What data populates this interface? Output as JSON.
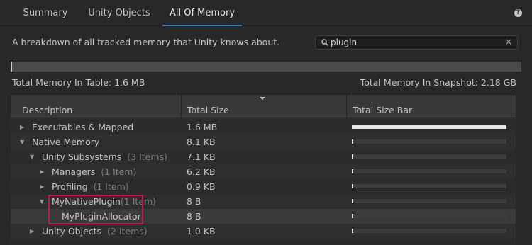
{
  "tabs": [
    {
      "label": "Summary"
    },
    {
      "label": "Unity Objects"
    },
    {
      "label": "All Of Memory"
    }
  ],
  "help_icon": "question-icon",
  "description": "A breakdown of all tracked memory that Unity knows about.",
  "search": {
    "value": "plugin",
    "clear": "×"
  },
  "usage_fraction": 0.0007,
  "totals": {
    "table": "Total Memory In Table: 1.6 MB",
    "snapshot": "Total Memory In Snapshot: 2.18 GB"
  },
  "columns": [
    "Description",
    "Total Size",
    "Total Size Bar"
  ],
  "rows": [
    {
      "name": "Executables & Mapped",
      "count": "",
      "size": "1.6 MB",
      "fraction": 1.0,
      "arrow": "▶"
    },
    {
      "name": "Native Memory",
      "count": "",
      "size": "8.1 KB",
      "fraction": 0.005,
      "arrow": "▼"
    },
    {
      "name": "Unity Subsystems",
      "count": "(3 Items)",
      "size": "7.1 KB",
      "fraction": 0.004,
      "arrow": "▼"
    },
    {
      "name": "Managers",
      "count": "(1 Item)",
      "size": "6.2 KB",
      "fraction": 0.004,
      "arrow": "▶"
    },
    {
      "name": "Profiling",
      "count": "(1 Item)",
      "size": "0.9 KB",
      "fraction": 0.001,
      "arrow": "▶"
    },
    {
      "name": "MyNativePlugin",
      "count": "(1 Item)",
      "size": "8 B",
      "fraction": 0.0005,
      "arrow": "▼"
    },
    {
      "name": "MyPluginAllocator",
      "count": "",
      "size": "8 B",
      "fraction": 0.0005,
      "arrow": ""
    },
    {
      "name": "Unity Objects",
      "count": "(2 Items)",
      "size": "1.0 KB",
      "fraction": 0.001,
      "arrow": "▶"
    }
  ]
}
